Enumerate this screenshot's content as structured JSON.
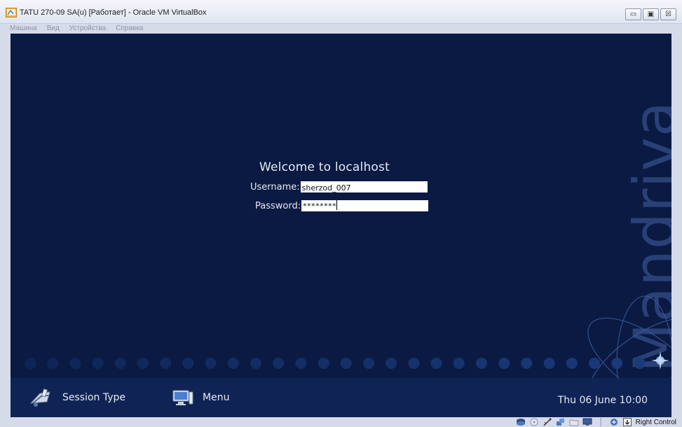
{
  "window": {
    "title": "TATU 270-09 SA(u) [Работает] - Oracle VM VirtualBox",
    "controls": {
      "minimize": "▭",
      "restore": "▣",
      "close": "☒"
    }
  },
  "menu": [
    "Машина",
    "Вид",
    "Устройства",
    "Справка"
  ],
  "guest": {
    "brand": "Mandriva",
    "welcome": "Welcome to localhost",
    "username_label": "Username:",
    "username_value": "sherzod_007",
    "password_label": "Password:",
    "password_mask": "********"
  },
  "panel": {
    "session_type": "Session Type",
    "menu": "Menu",
    "clock": "Thu 06 June 10:00"
  },
  "statusbar": {
    "icons": [
      "hard-disk-icon",
      "optical-drive-icon",
      "usb-icon",
      "network-icon",
      "shared-folders-icon",
      "display-icon",
      "mouse-integration-icon",
      "host-key-icon"
    ],
    "host_key": "Right Control"
  },
  "colors": {
    "vm_background": "#0a1a42",
    "panel": "#0f2355",
    "brand_text": "#2a4077",
    "dots": "#1a3a7a"
  }
}
